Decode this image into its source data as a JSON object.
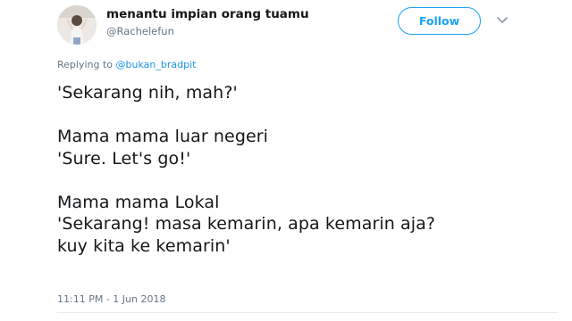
{
  "author": {
    "display_name": "menantu impian orang tuamu",
    "handle": "@Rachelefun"
  },
  "actions": {
    "follow_label": "Follow",
    "menu_icon": "chevron-down-icon"
  },
  "reply": {
    "prefix": "Replying to",
    "mention": "@bukan_bradpit"
  },
  "tweet": {
    "lines": [
      "'Sekarang nih, mah?'",
      "",
      "Mama mama luar negeri",
      "'Sure. Let's go!'",
      "",
      "Mama mama Lokal",
      "'Sekarang! masa kemarin, apa kemarin aja?",
      "kuy kita ke kemarin'"
    ],
    "timestamp": "11:11 PM - 1 Jun 2018"
  },
  "colors": {
    "accent": "#1da1f2",
    "text": "#14171a",
    "secondary": "#657786"
  }
}
